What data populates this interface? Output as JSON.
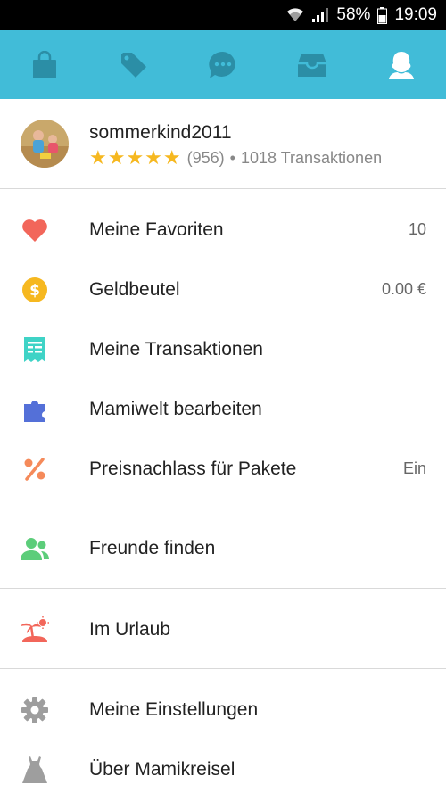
{
  "status_bar": {
    "battery": "58%",
    "time": "19:09"
  },
  "tabs": [
    {
      "name": "shop",
      "icon": "shopping-bag-icon"
    },
    {
      "name": "sell",
      "icon": "price-tag-icon"
    },
    {
      "name": "messages",
      "icon": "chat-bubble-icon"
    },
    {
      "name": "inbox",
      "icon": "inbox-tray-icon"
    },
    {
      "name": "profile",
      "icon": "profile-icon",
      "active": true
    }
  ],
  "colors": {
    "tab_bar": "#41bcd8",
    "star": "#f6b820",
    "heart": "#f2665a",
    "coin": "#f6b820",
    "receipt": "#3fd3c6",
    "puzzle": "#5470d8",
    "percent": "#f58a5a",
    "friends": "#5ccd7a",
    "vacation": "#f2665a",
    "gear": "#9e9e9e"
  },
  "profile": {
    "username": "sommerkind2011",
    "stars": "★★★★★",
    "rating_count": "(956)",
    "separator": "•",
    "transactions": "1018 Transaktionen"
  },
  "menu": {
    "favorites": {
      "label": "Meine Favoriten",
      "value": "10"
    },
    "wallet": {
      "label": "Geldbeutel",
      "value": "0.00 €"
    },
    "transactions": {
      "label": "Meine Transaktionen"
    },
    "mamiwelt": {
      "label": "Mamiwelt bearbeiten"
    },
    "bundle_discount": {
      "label": "Preisnachlass für Pakete",
      "value": "Ein"
    },
    "find_friends": {
      "label": "Freunde finden"
    },
    "vacation": {
      "label": "Im Urlaub"
    },
    "settings": {
      "label": "Meine Einstellungen"
    },
    "about": {
      "label": "Über Mamikreisel"
    }
  }
}
